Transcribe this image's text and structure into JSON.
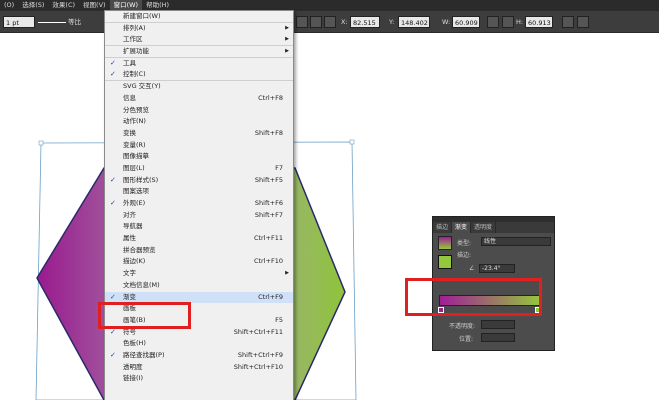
{
  "menubar": {
    "items": [
      "(O)",
      "选择(S)",
      "效果(C)",
      "视图(V)",
      "窗口(W)",
      "帮助(H)"
    ],
    "active_index": 4
  },
  "controlbar": {
    "stroke_weight": "1 pt",
    "stroke_style": "等比",
    "x_value": "82.515",
    "y_value": "148.402",
    "w_value": "60.909",
    "h_value": "60.913"
  },
  "window_menu": {
    "items": [
      {
        "label": "新建窗口(W)",
        "shortcut": "",
        "checked": false,
        "submenu": false,
        "sep": true
      },
      {
        "label": "排列(A)",
        "shortcut": "",
        "checked": false,
        "submenu": true,
        "sep": false
      },
      {
        "label": "工作区",
        "shortcut": "",
        "checked": false,
        "submenu": true,
        "sep": true
      },
      {
        "label": "扩展功能",
        "shortcut": "",
        "checked": false,
        "submenu": true,
        "sep": true
      },
      {
        "label": "工具",
        "shortcut": "",
        "checked": true,
        "submenu": false,
        "sep": false
      },
      {
        "label": "控制(C)",
        "shortcut": "",
        "checked": true,
        "submenu": false,
        "sep": true
      },
      {
        "label": "SVG 交互(Y)",
        "shortcut": "",
        "checked": false,
        "submenu": false,
        "sep": false
      },
      {
        "label": "信息",
        "shortcut": "Ctrl+F8",
        "checked": false,
        "submenu": false,
        "sep": false
      },
      {
        "label": "分色预览",
        "shortcut": "",
        "checked": false,
        "submenu": false,
        "sep": false
      },
      {
        "label": "动作(N)",
        "shortcut": "",
        "checked": false,
        "submenu": false,
        "sep": false
      },
      {
        "label": "变换",
        "shortcut": "Shift+F8",
        "checked": false,
        "submenu": false,
        "sep": false
      },
      {
        "label": "变量(R)",
        "shortcut": "",
        "checked": false,
        "submenu": false,
        "sep": false
      },
      {
        "label": "图像描摹",
        "shortcut": "",
        "checked": false,
        "submenu": false,
        "sep": false
      },
      {
        "label": "图层(L)",
        "shortcut": "F7",
        "checked": false,
        "submenu": false,
        "sep": false
      },
      {
        "label": "图形样式(S)",
        "shortcut": "Shift+F5",
        "checked": true,
        "submenu": false,
        "sep": false
      },
      {
        "label": "图案选项",
        "shortcut": "",
        "checked": false,
        "submenu": false,
        "sep": false
      },
      {
        "label": "外观(E)",
        "shortcut": "Shift+F6",
        "checked": true,
        "submenu": false,
        "sep": false
      },
      {
        "label": "对齐",
        "shortcut": "Shift+F7",
        "checked": false,
        "submenu": false,
        "sep": false
      },
      {
        "label": "导航器",
        "shortcut": "",
        "checked": false,
        "submenu": false,
        "sep": false
      },
      {
        "label": "属性",
        "shortcut": "Ctrl+F11",
        "checked": false,
        "submenu": false,
        "sep": false
      },
      {
        "label": "拼合器预览",
        "shortcut": "",
        "checked": false,
        "submenu": false,
        "sep": false
      },
      {
        "label": "描边(K)",
        "shortcut": "Ctrl+F10",
        "checked": false,
        "submenu": false,
        "sep": false
      },
      {
        "label": "文字",
        "shortcut": "",
        "checked": false,
        "submenu": true,
        "sep": false
      },
      {
        "label": "文档信息(M)",
        "shortcut": "",
        "checked": false,
        "submenu": false,
        "sep": false
      },
      {
        "label": "渐变",
        "shortcut": "Ctrl+F9",
        "checked": true,
        "submenu": false,
        "sep": false
      },
      {
        "label": "画板",
        "shortcut": "",
        "checked": false,
        "submenu": false,
        "sep": false
      },
      {
        "label": "画笔(B)",
        "shortcut": "F5",
        "checked": false,
        "submenu": false,
        "sep": false
      },
      {
        "label": "符号",
        "shortcut": "Shift+Ctrl+F11",
        "checked": true,
        "submenu": false,
        "sep": false
      },
      {
        "label": "色板(H)",
        "shortcut": "",
        "checked": false,
        "submenu": false,
        "sep": false
      },
      {
        "label": "路径查找器(P)",
        "shortcut": "Shift+Ctrl+F9",
        "checked": true,
        "submenu": false,
        "sep": false
      },
      {
        "label": "透明度",
        "shortcut": "Shift+Ctrl+F10",
        "checked": false,
        "submenu": false,
        "sep": false
      },
      {
        "label": "链接(I)",
        "shortcut": "",
        "checked": false,
        "submenu": false,
        "sep": false
      }
    ],
    "highlighted_index": 24
  },
  "gradient_panel": {
    "tabs": [
      "描边",
      "渐变",
      "透明度"
    ],
    "active_tab": 1,
    "type_label": "类型:",
    "type_value": "线性",
    "stroke_label": "描边:",
    "angle_value": "-23.4°",
    "opacity_label": "不透明度:",
    "location_label": "位置:",
    "gradient_start_color": "#a01e96",
    "gradient_end_color": "#94c83c"
  },
  "colors": {
    "highlight_red": "#e02020",
    "menu_highlight": "#cfe0f7",
    "shape_green": "#8fc43a"
  }
}
